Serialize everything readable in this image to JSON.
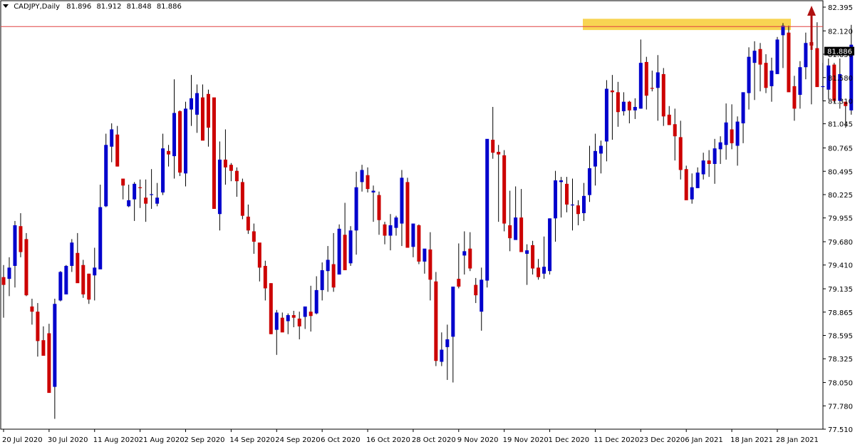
{
  "header": {
    "symbol": "CADJPY,Daily",
    "open": "81.896",
    "high": "81.912",
    "low": "81.848",
    "close": "81.886"
  },
  "colors": {
    "bull": "#0000cc",
    "bear": "#cc0000",
    "wick": "#000000",
    "resistance_line": "#e04040",
    "zone": "#f5c518",
    "arrow": "#b01010",
    "current_price_bg": "#000000",
    "current_price_text": "#ffffff"
  },
  "chart_data": {
    "type": "candlestick",
    "title": "CADJPY,Daily",
    "y_ticks": [
      "82.395",
      "82.120",
      "81.850",
      "81.580",
      "81.310",
      "81.045",
      "80.765",
      "80.495",
      "80.225",
      "79.955",
      "79.680",
      "79.410",
      "79.135",
      "78.865",
      "78.595",
      "78.325",
      "78.050",
      "77.780",
      "77.510"
    ],
    "ylim": [
      77.51,
      82.395
    ],
    "x_ticks": [
      "20 Jul 2020",
      "30 Jul 2020",
      "11 Aug 2020",
      "21 Aug 2020",
      "2 Sep 2020",
      "14 Sep 2020",
      "24 Sep 2020",
      "6 Oct 2020",
      "16 Oct 2020",
      "28 Oct 2020",
      "9 Nov 2020",
      "19 Nov 2020",
      "1 Dec 2020",
      "11 Dec 2020",
      "23 Dec 2020",
      "6 Jan 2021",
      "18 Jan 2021",
      "28 Jan 2021"
    ],
    "current_price": "81.886",
    "resistance_level": 82.17,
    "resistance_zone": [
      82.13,
      82.26
    ],
    "candles": [
      [
        79.27,
        79.41,
        78.8,
        79.18
      ],
      [
        79.25,
        79.5,
        79.05,
        79.38
      ],
      [
        79.4,
        79.92,
        79.15,
        79.87
      ],
      [
        79.86,
        80.01,
        79.5,
        79.56
      ],
      [
        79.71,
        79.78,
        79.05,
        79.06
      ],
      [
        78.93,
        79.02,
        78.72,
        78.87
      ],
      [
        78.87,
        78.97,
        78.35,
        78.53
      ],
      [
        78.54,
        78.7,
        78.37,
        78.36
      ],
      [
        78.62,
        78.73,
        77.96,
        77.93
      ],
      [
        78.0,
        79.02,
        77.63,
        78.96
      ],
      [
        79.0,
        79.34,
        78.99,
        79.33
      ],
      [
        79.07,
        79.41,
        79.1,
        79.4
      ],
      [
        79.4,
        79.71,
        79.33,
        79.67
      ],
      [
        79.55,
        79.78,
        79.24,
        79.2
      ],
      [
        79.41,
        79.47,
        79.03,
        79.07
      ],
      [
        79.31,
        79.31,
        78.96,
        79.01
      ],
      [
        79.29,
        79.61,
        79.0,
        79.38
      ],
      [
        79.36,
        80.34,
        79.4,
        80.08
      ],
      [
        80.09,
        80.93,
        80.08,
        80.8
      ],
      [
        80.78,
        81.05,
        80.6,
        80.98
      ],
      [
        80.92,
        81.02,
        80.55,
        80.55
      ],
      [
        80.41,
        80.38,
        80.17,
        80.33
      ],
      [
        80.09,
        80.34,
        80.08,
        80.16
      ],
      [
        80.17,
        80.37,
        79.92,
        80.35
      ],
      [
        80.31,
        80.4,
        80.07,
        80.3
      ],
      [
        80.19,
        80.4,
        79.91,
        80.12
      ],
      [
        80.22,
        80.52,
        80.06,
        80.23
      ],
      [
        80.12,
        80.36,
        80.09,
        80.19
      ],
      [
        80.25,
        80.93,
        80.22,
        80.76
      ],
      [
        80.73,
        80.8,
        80.55,
        80.69
      ],
      [
        80.67,
        81.56,
        80.41,
        81.17
      ],
      [
        81.19,
        81.2,
        80.44,
        80.48
      ],
      [
        80.47,
        81.3,
        80.32,
        81.22
      ],
      [
        81.21,
        81.61,
        81.02,
        81.34
      ],
      [
        81.15,
        81.5,
        80.94,
        81.4
      ],
      [
        81.35,
        81.5,
        80.98,
        80.85
      ],
      [
        81.39,
        81.44,
        80.78,
        81.0
      ],
      [
        81.35,
        81.33,
        80.39,
        80.06
      ],
      [
        80.0,
        80.84,
        79.81,
        80.63
      ],
      [
        80.63,
        80.98,
        80.34,
        80.54
      ],
      [
        80.57,
        80.59,
        80.38,
        80.5
      ],
      [
        80.5,
        80.54,
        80.2,
        80.38
      ],
      [
        80.37,
        80.41,
        79.94,
        79.98
      ],
      [
        79.97,
        80.11,
        79.77,
        79.81
      ],
      [
        79.8,
        79.89,
        79.54,
        79.68
      ],
      [
        79.67,
        79.52,
        79.22,
        79.38
      ],
      [
        79.4,
        79.46,
        79.0,
        79.14
      ],
      [
        79.2,
        79.2,
        78.61,
        78.61
      ],
      [
        78.66,
        78.89,
        78.37,
        78.86
      ],
      [
        78.8,
        78.86,
        78.68,
        78.63
      ],
      [
        78.76,
        78.85,
        78.61,
        78.83
      ],
      [
        78.83,
        78.88,
        78.69,
        78.8
      ],
      [
        78.79,
        78.87,
        78.55,
        78.7
      ],
      [
        78.81,
        78.87,
        78.67,
        78.93
      ],
      [
        78.87,
        79.17,
        78.64,
        78.82
      ],
      [
        78.85,
        79.28,
        78.84,
        79.12
      ],
      [
        79.12,
        79.44,
        79.0,
        79.35
      ],
      [
        79.34,
        79.63,
        79.1,
        79.47
      ],
      [
        79.42,
        79.78,
        79.1,
        79.15
      ],
      [
        79.3,
        79.88,
        79.34,
        79.83
      ],
      [
        79.76,
        80.13,
        79.38,
        79.35
      ],
      [
        79.43,
        79.86,
        79.4,
        79.81
      ],
      [
        79.81,
        80.49,
        79.53,
        80.31
      ],
      [
        80.37,
        80.57,
        80.26,
        80.51
      ],
      [
        80.45,
        80.54,
        80.25,
        80.29
      ],
      [
        80.25,
        80.33,
        79.91,
        80.27
      ],
      [
        80.22,
        80.26,
        79.76,
        79.93
      ],
      [
        79.88,
        79.91,
        79.65,
        79.75
      ],
      [
        79.75,
        80.0,
        79.58,
        79.87
      ],
      [
        79.84,
        79.98,
        79.75,
        79.96
      ],
      [
        79.89,
        80.51,
        79.63,
        80.42
      ],
      [
        80.37,
        80.42,
        79.7,
        79.61
      ],
      [
        79.62,
        79.78,
        79.5,
        79.89
      ],
      [
        79.87,
        79.88,
        79.42,
        79.45
      ],
      [
        79.45,
        79.59,
        79.31,
        79.6
      ],
      [
        79.59,
        79.79,
        79.0,
        79.24
      ],
      [
        79.22,
        79.33,
        78.24,
        78.3
      ],
      [
        78.29,
        78.63,
        78.24,
        78.43
      ],
      [
        78.46,
        78.72,
        78.08,
        78.55
      ],
      [
        78.58,
        79.14,
        78.05,
        79.16
      ],
      [
        79.25,
        79.66,
        79.14,
        79.16
      ],
      [
        79.52,
        79.8,
        79.3,
        79.57
      ],
      [
        79.6,
        79.79,
        79.34,
        79.37
      ],
      [
        79.18,
        79.26,
        78.97,
        79.06
      ],
      [
        78.87,
        79.38,
        78.65,
        79.24
      ],
      [
        79.23,
        80.85,
        79.15,
        80.87
      ],
      [
        80.86,
        81.24,
        80.64,
        80.71
      ],
      [
        80.72,
        80.8,
        79.91,
        80.69
      ],
      [
        80.68,
        80.74,
        79.8,
        79.89
      ],
      [
        79.87,
        80.27,
        79.57,
        79.72
      ],
      [
        79.7,
        80.32,
        79.71,
        79.96
      ],
      [
        79.96,
        80.29,
        79.59,
        79.56
      ],
      [
        79.54,
        79.65,
        79.18,
        79.58
      ],
      [
        79.64,
        79.69,
        79.3,
        79.37
      ],
      [
        79.38,
        79.48,
        79.24,
        79.27
      ],
      [
        79.31,
        79.74,
        79.25,
        79.39
      ],
      [
        79.34,
        79.95,
        79.3,
        79.95
      ],
      [
        79.95,
        80.5,
        79.68,
        80.39
      ],
      [
        80.37,
        80.43,
        79.96,
        80.39
      ],
      [
        80.35,
        80.43,
        80.02,
        80.11
      ],
      [
        80.1,
        80.41,
        79.81,
        80.11
      ],
      [
        80.1,
        80.16,
        79.87,
        80.0
      ],
      [
        80.01,
        80.36,
        79.92,
        80.21
      ],
      [
        80.22,
        80.79,
        80.14,
        80.53
      ],
      [
        80.55,
        80.93,
        80.33,
        80.73
      ],
      [
        80.7,
        80.85,
        80.47,
        80.79
      ],
      [
        80.84,
        81.55,
        80.61,
        81.45
      ],
      [
        81.43,
        81.61,
        80.86,
        81.41
      ],
      [
        81.41,
        81.53,
        81.01,
        81.18
      ],
      [
        81.19,
        81.41,
        81.14,
        81.3
      ],
      [
        81.3,
        81.31,
        81.05,
        81.2
      ],
      [
        81.2,
        81.34,
        81.1,
        81.24
      ],
      [
        81.22,
        82.02,
        81.22,
        81.75
      ],
      [
        81.76,
        81.82,
        81.21,
        81.37
      ],
      [
        81.46,
        81.66,
        81.42,
        81.45
      ],
      [
        81.46,
        81.84,
        81.08,
        81.64
      ],
      [
        81.62,
        81.69,
        81.02,
        81.13
      ],
      [
        81.15,
        81.25,
        81.06,
        81.03
      ],
      [
        81.04,
        81.22,
        80.62,
        80.9
      ],
      [
        80.89,
        81.08,
        80.4,
        80.51
      ],
      [
        80.52,
        80.56,
        80.2,
        80.16
      ],
      [
        80.17,
        80.47,
        80.12,
        80.31
      ],
      [
        80.3,
        80.54,
        80.35,
        80.48
      ],
      [
        80.46,
        80.71,
        80.4,
        80.62
      ],
      [
        80.62,
        80.74,
        80.43,
        80.58
      ],
      [
        80.58,
        80.87,
        80.35,
        80.76
      ],
      [
        80.75,
        80.9,
        80.58,
        80.83
      ],
      [
        80.8,
        81.28,
        80.63,
        81.06
      ],
      [
        80.98,
        81.27,
        80.75,
        80.82
      ],
      [
        80.79,
        81.13,
        80.56,
        81.07
      ],
      [
        81.05,
        81.39,
        80.82,
        81.41
      ],
      [
        81.4,
        81.93,
        81.21,
        81.82
      ],
      [
        81.75,
        82.0,
        81.32,
        81.89
      ],
      [
        81.91,
        81.98,
        81.42,
        81.73
      ],
      [
        81.75,
        81.85,
        81.4,
        81.46
      ],
      [
        81.48,
        81.81,
        81.3,
        81.66
      ],
      [
        81.62,
        82.05,
        81.7,
        82.02
      ],
      [
        82.07,
        82.21,
        81.69,
        82.18
      ],
      [
        82.1,
        82.18,
        81.56,
        81.41
      ],
      [
        81.48,
        81.6,
        81.08,
        81.22
      ],
      [
        81.38,
        81.77,
        81.22,
        81.7
      ],
      [
        81.7,
        82.1,
        81.56,
        81.98
      ],
      [
        81.99,
        82.03,
        81.27,
        81.95
      ],
      [
        81.92,
        82.22,
        81.86,
        81.47
      ],
      [
        81.47,
        81.75,
        81.31,
        81.48
      ],
      [
        81.44,
        81.8,
        81.33,
        81.72
      ],
      [
        81.73,
        81.75,
        81.29,
        81.31
      ],
      [
        81.31,
        81.8,
        81.22,
        81.62
      ],
      [
        81.3,
        81.28,
        81.0,
        81.25
      ],
      [
        81.2,
        82.19,
        81.15,
        81.96
      ],
      [
        81.9,
        81.91,
        81.85,
        81.89
      ]
    ]
  }
}
